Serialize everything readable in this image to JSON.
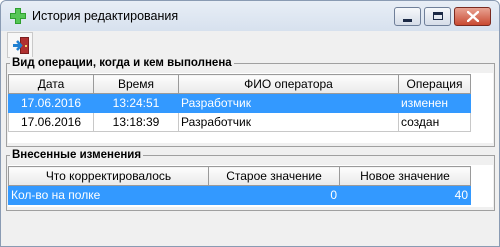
{
  "window": {
    "title": "История редактирования"
  },
  "toolbar": {
    "exit_icon": "exit-door-icon"
  },
  "operations": {
    "title": "Вид операции, когда и кем выполнена",
    "columns": [
      "Дата",
      "Время",
      "ФИО оператора",
      "Операция"
    ],
    "rows": [
      {
        "date": "17.06.2016",
        "time": "13:24:51",
        "operator": "Разработчик",
        "operation": "изменен",
        "selected": true
      },
      {
        "date": "17.06.2016",
        "time": "13:18:39",
        "operator": "Разработчик",
        "operation": "создан",
        "selected": false
      }
    ]
  },
  "changes": {
    "title": "Внесенные изменения",
    "columns": [
      "Что корректировалось",
      "Старое значение",
      "Новое значение"
    ],
    "rows": [
      {
        "field": "Кол-во на полке",
        "old_value": "0",
        "new_value": "40",
        "selected": true
      }
    ]
  },
  "colors": {
    "selection": "#3399ff",
    "accent_icon": "#2fa02f"
  }
}
